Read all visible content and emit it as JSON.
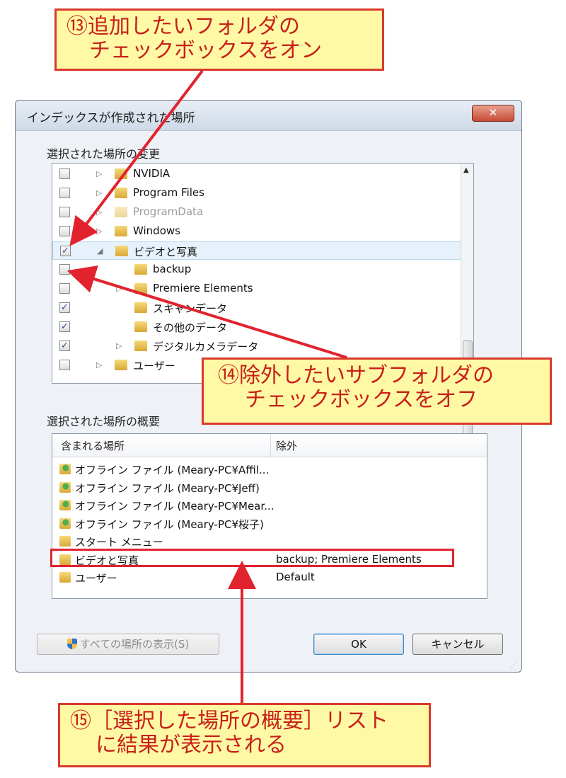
{
  "callouts": {
    "c13": {
      "line1": "⑬追加したいフォルダの",
      "line2": "チェックボックスをオン"
    },
    "c14": {
      "line1": "⑭除外したいサブフォルダの",
      "line2": "チェックボックスをオフ"
    },
    "c15": {
      "line1": "⑮［選択した場所の概要］リスト",
      "line2": "に結果が表示される"
    }
  },
  "dialog": {
    "title": "インデックスが作成された場所",
    "close_label": "✕",
    "change_group_label": "選択された場所の変更",
    "summary_group_label": "選択された場所の概要",
    "tree": [
      {
        "label": "NVIDIA",
        "checked": false,
        "expander": "▷",
        "level": 1,
        "gray": false
      },
      {
        "label": "Program Files",
        "checked": false,
        "expander": "▷",
        "level": 1,
        "gray": false
      },
      {
        "label": "ProgramData",
        "checked": false,
        "expander": "▷",
        "level": 1,
        "gray": true
      },
      {
        "label": "Windows",
        "checked": false,
        "expander": "▷",
        "level": 1,
        "gray": false
      },
      {
        "label": "ビデオと写真",
        "checked": true,
        "expander": "◢",
        "level": 1,
        "gray": false,
        "selected": true
      },
      {
        "label": "backup",
        "checked": false,
        "expander": "",
        "level": 2,
        "gray": false
      },
      {
        "label": "Premiere Elements",
        "checked": false,
        "expander": "▷",
        "level": 2,
        "gray": false
      },
      {
        "label": "スキャンデータ",
        "checked": true,
        "expander": "",
        "level": 2,
        "gray": false
      },
      {
        "label": "その他のデータ",
        "checked": true,
        "expander": "",
        "level": 2,
        "gray": false
      },
      {
        "label": "デジタルカメラデータ",
        "checked": true,
        "expander": "▷",
        "level": 2,
        "gray": false
      },
      {
        "label": "ユーザー",
        "checked": false,
        "expander": "▷",
        "level": 1,
        "gray": false
      }
    ],
    "summary": {
      "col_included": "含まれる場所",
      "col_excluded": "除外",
      "rows": [
        {
          "name": "オフライン ファイル (Meary-PC¥Affil...",
          "excluded": "",
          "icon": "offline-folder-icon"
        },
        {
          "name": "オフライン ファイル (Meary-PC¥Jeff)",
          "excluded": "",
          "icon": "offline-folder-icon"
        },
        {
          "name": "オフライン ファイル (Meary-PC¥Mear...",
          "excluded": "",
          "icon": "offline-folder-icon"
        },
        {
          "name": "オフライン ファイル (Meary-PC¥桜子)",
          "excluded": "",
          "icon": "offline-folder-icon"
        },
        {
          "name": "スタート メニュー",
          "excluded": "",
          "icon": "folder-icon"
        },
        {
          "name": "ビデオと写真",
          "excluded": "backup; Premiere Elements",
          "icon": "folder-icon"
        },
        {
          "name": "ユーザー",
          "excluded": "Default",
          "icon": "folder-icon"
        }
      ]
    },
    "buttons": {
      "show_all": "すべての場所の表示(S)",
      "ok": "OK",
      "cancel": "キャンセル"
    }
  },
  "colors": {
    "callout_bg": "#fff9a6",
    "callout_border": "#d93a2b",
    "arrow": "#e1232e"
  }
}
